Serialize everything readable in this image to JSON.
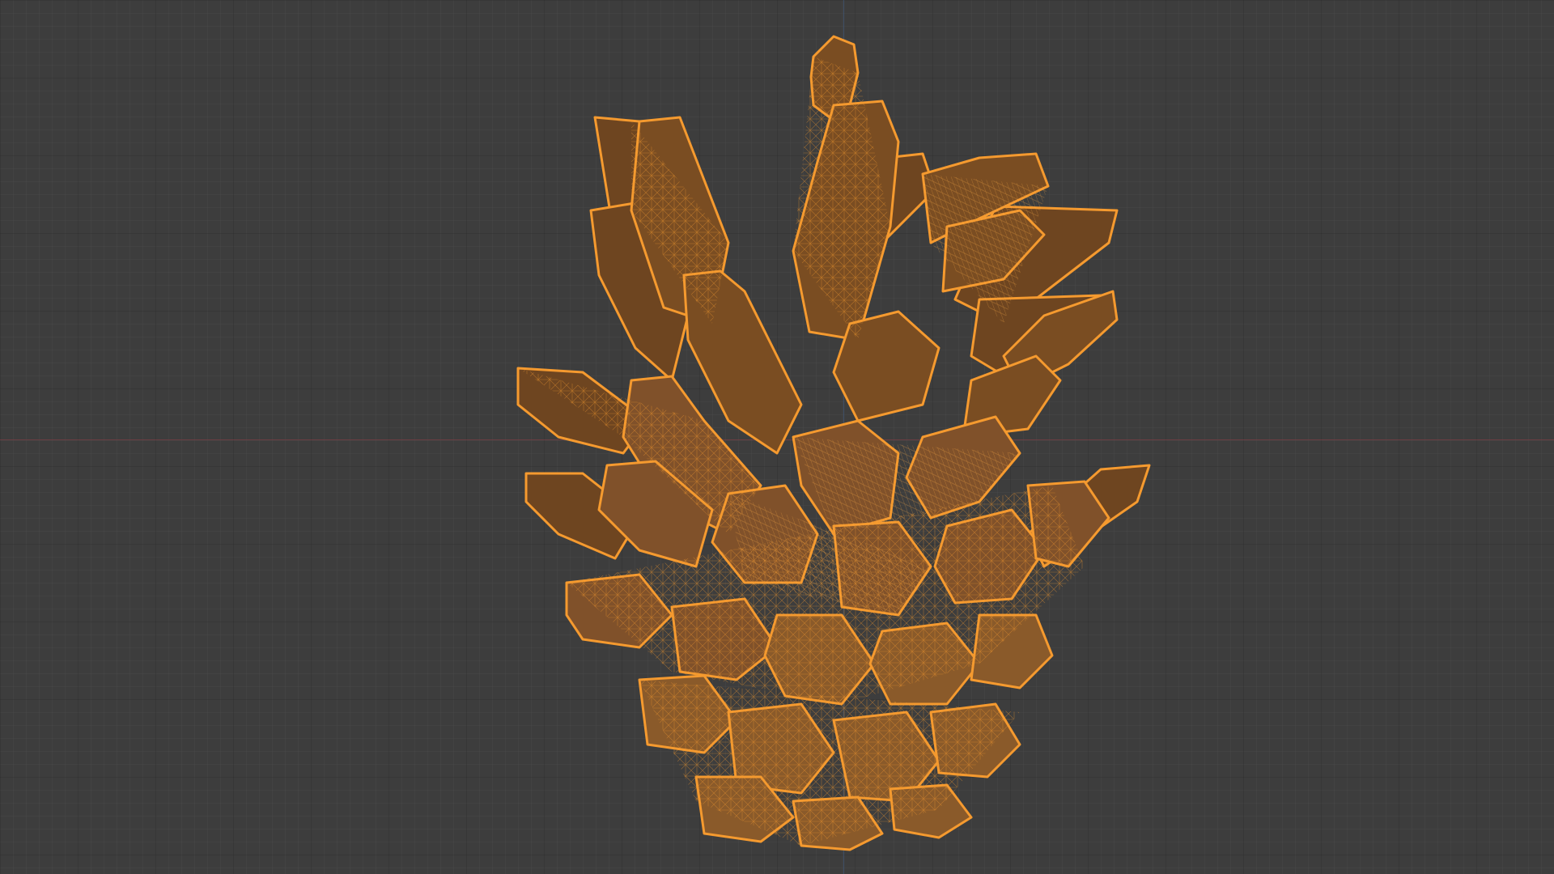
{
  "viewport": {
    "background_color": "#3d3d3d",
    "grid_color": "#353535",
    "x_axis_color": "#7a3d44",
    "z_axis_color": "#44608a"
  },
  "model": {
    "object": "pine cone",
    "display_mode": "wireframe",
    "selected": true,
    "wire_color": "#f0962d",
    "fill_color": "#8a5a2a"
  }
}
